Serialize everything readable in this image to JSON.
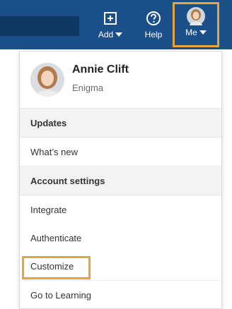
{
  "nav": {
    "add_label": "Add",
    "help_label": "Help",
    "me_label": "Me"
  },
  "profile": {
    "name": "Annie Clift",
    "organization": "Enigma"
  },
  "menu": {
    "updates_header": "Updates",
    "whats_new": "What’s new",
    "account_settings_header": "Account settings",
    "integrate": "Integrate",
    "authenticate": "Authenticate",
    "customize": "Customize",
    "go_to_learning": "Go to Learning"
  },
  "colors": {
    "topbar": "#1a4f8a",
    "highlight": "#e8a33a"
  }
}
